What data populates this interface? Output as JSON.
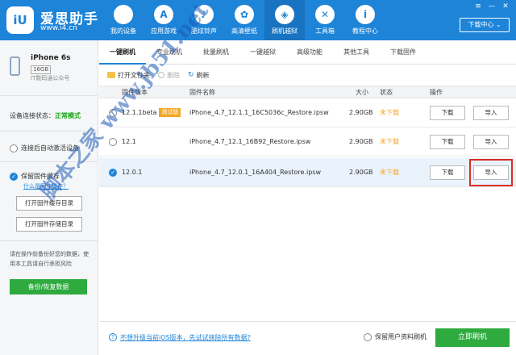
{
  "app": {
    "brand_name": "爱思助手",
    "brand_url": "www.i4.cn",
    "logo_text": "iU"
  },
  "nav": [
    {
      "label": "我的设备",
      "icon": "apple-icon",
      "glyph": ""
    },
    {
      "label": "应用游戏",
      "icon": "app-store-icon",
      "glyph": "A"
    },
    {
      "label": "酷炫铃声",
      "icon": "bell-icon",
      "glyph": "♪"
    },
    {
      "label": "高清壁纸",
      "icon": "flower-icon",
      "glyph": "✿"
    },
    {
      "label": "刷机越狱",
      "icon": "dropbox-icon",
      "glyph": "◈"
    },
    {
      "label": "工具箱",
      "icon": "tools-icon",
      "glyph": "✕"
    },
    {
      "label": "教程中心",
      "icon": "info-icon",
      "glyph": "i"
    }
  ],
  "window_controls": {
    "menu": "≡",
    "minimize": "—",
    "close": "✕"
  },
  "download_center": "下载中心 ⌄",
  "device": {
    "name": "iPhone 6s",
    "capacity": "16GB",
    "subtitle": "IT数码通公众号"
  },
  "sidebar": {
    "status_label": "设备连接状态：",
    "status_value": "正常模式",
    "auto_activate": "连接后自动激活设备",
    "keep_cache": "保留固件缓存",
    "what_is_cache": "什么是固件缓存？",
    "open_cache_dir": "打开固件缓存目录",
    "open_storage_dir": "打开固件存储目录",
    "note": "请在操作前备份好您的数据，使用本工具请自行承担风险",
    "backup_button": "备份/恢复数据"
  },
  "tabs": [
    "一键刷机",
    "专业刷机",
    "批量刷机",
    "一键越狱",
    "高级功能",
    "其他工具",
    "下载固件"
  ],
  "toolbar": {
    "open_folder": "打开文件夹",
    "delete": "删除",
    "refresh": "刷新"
  },
  "table": {
    "columns": {
      "version": "固件版本",
      "name": "固件名称",
      "size": "大小",
      "status": "状态",
      "actions": "操作"
    },
    "rows": [
      {
        "version": "12.1.1beta",
        "badge": "测试版",
        "name": "iPhone_4.7_12.1.1_16C5036c_Restore.ipsw",
        "size": "2.90GB",
        "status": "未下载",
        "download": "下载",
        "import": "导入",
        "selected": false
      },
      {
        "version": "12.1",
        "badge": "",
        "name": "iPhone_4.7_12.1_16B92_Restore.ipsw",
        "size": "2.90GB",
        "status": "未下载",
        "download": "下载",
        "import": "导入",
        "selected": false
      },
      {
        "version": "12.0.1",
        "badge": "",
        "name": "iPhone_4.7_12.0.1_16A404_Restore.ipsw",
        "size": "2.90GB",
        "status": "未下载",
        "download": "下载",
        "import": "导入",
        "selected": true
      }
    ]
  },
  "footer": {
    "info_link": "不想升级当前iOS版本，先试试抹除所有数据?",
    "keep_user_data": "保留用户资料刷机",
    "flash_button": "立即刷机"
  },
  "watermark": "脚本之家 www.jb51.net"
}
